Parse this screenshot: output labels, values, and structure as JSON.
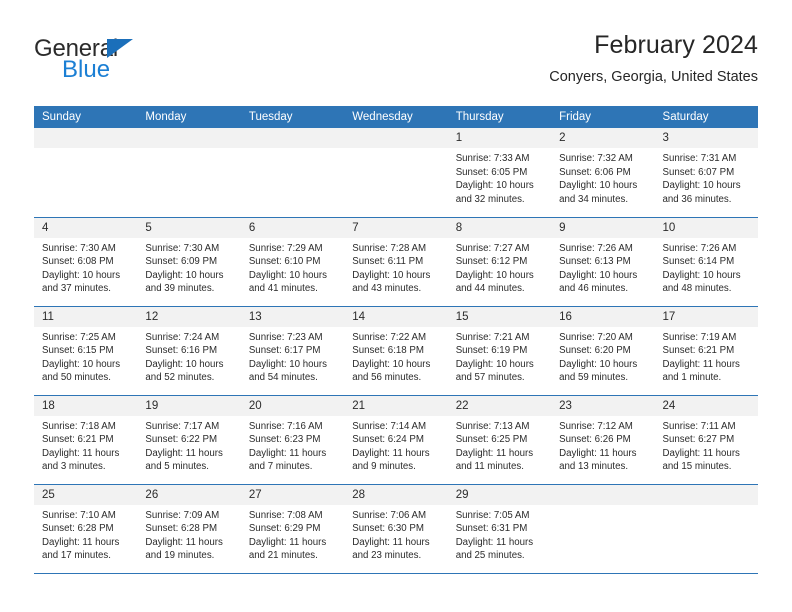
{
  "brand": {
    "name_top": "General",
    "name_bottom": "Blue",
    "accent_color": "#1b7fd4"
  },
  "header": {
    "title": "February 2024",
    "subtitle": "Conyers, Georgia, United States"
  },
  "theme": {
    "header_blue": "#2e75b6",
    "daynum_gray": "#f2f2f2"
  },
  "weekdays": [
    "Sunday",
    "Monday",
    "Tuesday",
    "Wednesday",
    "Thursday",
    "Friday",
    "Saturday"
  ],
  "weeks": [
    [
      {
        "day": "",
        "sunrise": "",
        "sunset": "",
        "daylight_1": "",
        "daylight_2": ""
      },
      {
        "day": "",
        "sunrise": "",
        "sunset": "",
        "daylight_1": "",
        "daylight_2": ""
      },
      {
        "day": "",
        "sunrise": "",
        "sunset": "",
        "daylight_1": "",
        "daylight_2": ""
      },
      {
        "day": "",
        "sunrise": "",
        "sunset": "",
        "daylight_1": "",
        "daylight_2": ""
      },
      {
        "day": "1",
        "sunrise": "Sunrise: 7:33 AM",
        "sunset": "Sunset: 6:05 PM",
        "daylight_1": "Daylight: 10 hours",
        "daylight_2": "and 32 minutes."
      },
      {
        "day": "2",
        "sunrise": "Sunrise: 7:32 AM",
        "sunset": "Sunset: 6:06 PM",
        "daylight_1": "Daylight: 10 hours",
        "daylight_2": "and 34 minutes."
      },
      {
        "day": "3",
        "sunrise": "Sunrise: 7:31 AM",
        "sunset": "Sunset: 6:07 PM",
        "daylight_1": "Daylight: 10 hours",
        "daylight_2": "and 36 minutes."
      }
    ],
    [
      {
        "day": "4",
        "sunrise": "Sunrise: 7:30 AM",
        "sunset": "Sunset: 6:08 PM",
        "daylight_1": "Daylight: 10 hours",
        "daylight_2": "and 37 minutes."
      },
      {
        "day": "5",
        "sunrise": "Sunrise: 7:30 AM",
        "sunset": "Sunset: 6:09 PM",
        "daylight_1": "Daylight: 10 hours",
        "daylight_2": "and 39 minutes."
      },
      {
        "day": "6",
        "sunrise": "Sunrise: 7:29 AM",
        "sunset": "Sunset: 6:10 PM",
        "daylight_1": "Daylight: 10 hours",
        "daylight_2": "and 41 minutes."
      },
      {
        "day": "7",
        "sunrise": "Sunrise: 7:28 AM",
        "sunset": "Sunset: 6:11 PM",
        "daylight_1": "Daylight: 10 hours",
        "daylight_2": "and 43 minutes."
      },
      {
        "day": "8",
        "sunrise": "Sunrise: 7:27 AM",
        "sunset": "Sunset: 6:12 PM",
        "daylight_1": "Daylight: 10 hours",
        "daylight_2": "and 44 minutes."
      },
      {
        "day": "9",
        "sunrise": "Sunrise: 7:26 AM",
        "sunset": "Sunset: 6:13 PM",
        "daylight_1": "Daylight: 10 hours",
        "daylight_2": "and 46 minutes."
      },
      {
        "day": "10",
        "sunrise": "Sunrise: 7:26 AM",
        "sunset": "Sunset: 6:14 PM",
        "daylight_1": "Daylight: 10 hours",
        "daylight_2": "and 48 minutes."
      }
    ],
    [
      {
        "day": "11",
        "sunrise": "Sunrise: 7:25 AM",
        "sunset": "Sunset: 6:15 PM",
        "daylight_1": "Daylight: 10 hours",
        "daylight_2": "and 50 minutes."
      },
      {
        "day": "12",
        "sunrise": "Sunrise: 7:24 AM",
        "sunset": "Sunset: 6:16 PM",
        "daylight_1": "Daylight: 10 hours",
        "daylight_2": "and 52 minutes."
      },
      {
        "day": "13",
        "sunrise": "Sunrise: 7:23 AM",
        "sunset": "Sunset: 6:17 PM",
        "daylight_1": "Daylight: 10 hours",
        "daylight_2": "and 54 minutes."
      },
      {
        "day": "14",
        "sunrise": "Sunrise: 7:22 AM",
        "sunset": "Sunset: 6:18 PM",
        "daylight_1": "Daylight: 10 hours",
        "daylight_2": "and 56 minutes."
      },
      {
        "day": "15",
        "sunrise": "Sunrise: 7:21 AM",
        "sunset": "Sunset: 6:19 PM",
        "daylight_1": "Daylight: 10 hours",
        "daylight_2": "and 57 minutes."
      },
      {
        "day": "16",
        "sunrise": "Sunrise: 7:20 AM",
        "sunset": "Sunset: 6:20 PM",
        "daylight_1": "Daylight: 10 hours",
        "daylight_2": "and 59 minutes."
      },
      {
        "day": "17",
        "sunrise": "Sunrise: 7:19 AM",
        "sunset": "Sunset: 6:21 PM",
        "daylight_1": "Daylight: 11 hours",
        "daylight_2": "and 1 minute."
      }
    ],
    [
      {
        "day": "18",
        "sunrise": "Sunrise: 7:18 AM",
        "sunset": "Sunset: 6:21 PM",
        "daylight_1": "Daylight: 11 hours",
        "daylight_2": "and 3 minutes."
      },
      {
        "day": "19",
        "sunrise": "Sunrise: 7:17 AM",
        "sunset": "Sunset: 6:22 PM",
        "daylight_1": "Daylight: 11 hours",
        "daylight_2": "and 5 minutes."
      },
      {
        "day": "20",
        "sunrise": "Sunrise: 7:16 AM",
        "sunset": "Sunset: 6:23 PM",
        "daylight_1": "Daylight: 11 hours",
        "daylight_2": "and 7 minutes."
      },
      {
        "day": "21",
        "sunrise": "Sunrise: 7:14 AM",
        "sunset": "Sunset: 6:24 PM",
        "daylight_1": "Daylight: 11 hours",
        "daylight_2": "and 9 minutes."
      },
      {
        "day": "22",
        "sunrise": "Sunrise: 7:13 AM",
        "sunset": "Sunset: 6:25 PM",
        "daylight_1": "Daylight: 11 hours",
        "daylight_2": "and 11 minutes."
      },
      {
        "day": "23",
        "sunrise": "Sunrise: 7:12 AM",
        "sunset": "Sunset: 6:26 PM",
        "daylight_1": "Daylight: 11 hours",
        "daylight_2": "and 13 minutes."
      },
      {
        "day": "24",
        "sunrise": "Sunrise: 7:11 AM",
        "sunset": "Sunset: 6:27 PM",
        "daylight_1": "Daylight: 11 hours",
        "daylight_2": "and 15 minutes."
      }
    ],
    [
      {
        "day": "25",
        "sunrise": "Sunrise: 7:10 AM",
        "sunset": "Sunset: 6:28 PM",
        "daylight_1": "Daylight: 11 hours",
        "daylight_2": "and 17 minutes."
      },
      {
        "day": "26",
        "sunrise": "Sunrise: 7:09 AM",
        "sunset": "Sunset: 6:28 PM",
        "daylight_1": "Daylight: 11 hours",
        "daylight_2": "and 19 minutes."
      },
      {
        "day": "27",
        "sunrise": "Sunrise: 7:08 AM",
        "sunset": "Sunset: 6:29 PM",
        "daylight_1": "Daylight: 11 hours",
        "daylight_2": "and 21 minutes."
      },
      {
        "day": "28",
        "sunrise": "Sunrise: 7:06 AM",
        "sunset": "Sunset: 6:30 PM",
        "daylight_1": "Daylight: 11 hours",
        "daylight_2": "and 23 minutes."
      },
      {
        "day": "29",
        "sunrise": "Sunrise: 7:05 AM",
        "sunset": "Sunset: 6:31 PM",
        "daylight_1": "Daylight: 11 hours",
        "daylight_2": "and 25 minutes."
      },
      {
        "day": "",
        "sunrise": "",
        "sunset": "",
        "daylight_1": "",
        "daylight_2": ""
      },
      {
        "day": "",
        "sunrise": "",
        "sunset": "",
        "daylight_1": "",
        "daylight_2": ""
      }
    ]
  ]
}
